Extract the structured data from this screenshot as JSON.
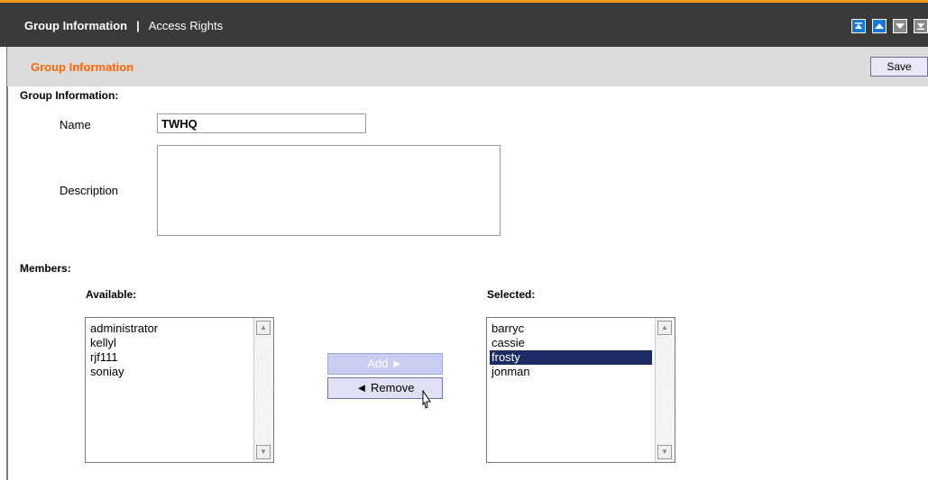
{
  "tabs": {
    "active": "Group Information",
    "separator": "|",
    "inactive": "Access Rights"
  },
  "toolbar_icons": [
    "move-top-icon",
    "move-up-icon",
    "move-down-icon",
    "move-bottom-icon"
  ],
  "subheader": {
    "title": "Group Information",
    "save_label": "Save"
  },
  "form": {
    "section_title": "Group Information:",
    "name_label": "Name",
    "name_value": "TWHQ",
    "description_label": "Description",
    "description_value": ""
  },
  "members": {
    "section_title": "Members:",
    "available_label": "Available:",
    "selected_label": "Selected:",
    "available": [
      "administrator",
      "kellyl",
      "rjf111",
      "soniay"
    ],
    "selected": [
      "barryc",
      "cassie",
      "frosty",
      "jonman"
    ],
    "selected_highlight": "frosty",
    "add_label": "Add ►",
    "remove_label": "◄ Remove"
  },
  "colors": {
    "accent": "#ff6600",
    "topbar": "#3a3a3a",
    "highlight": "#1c2b64"
  }
}
